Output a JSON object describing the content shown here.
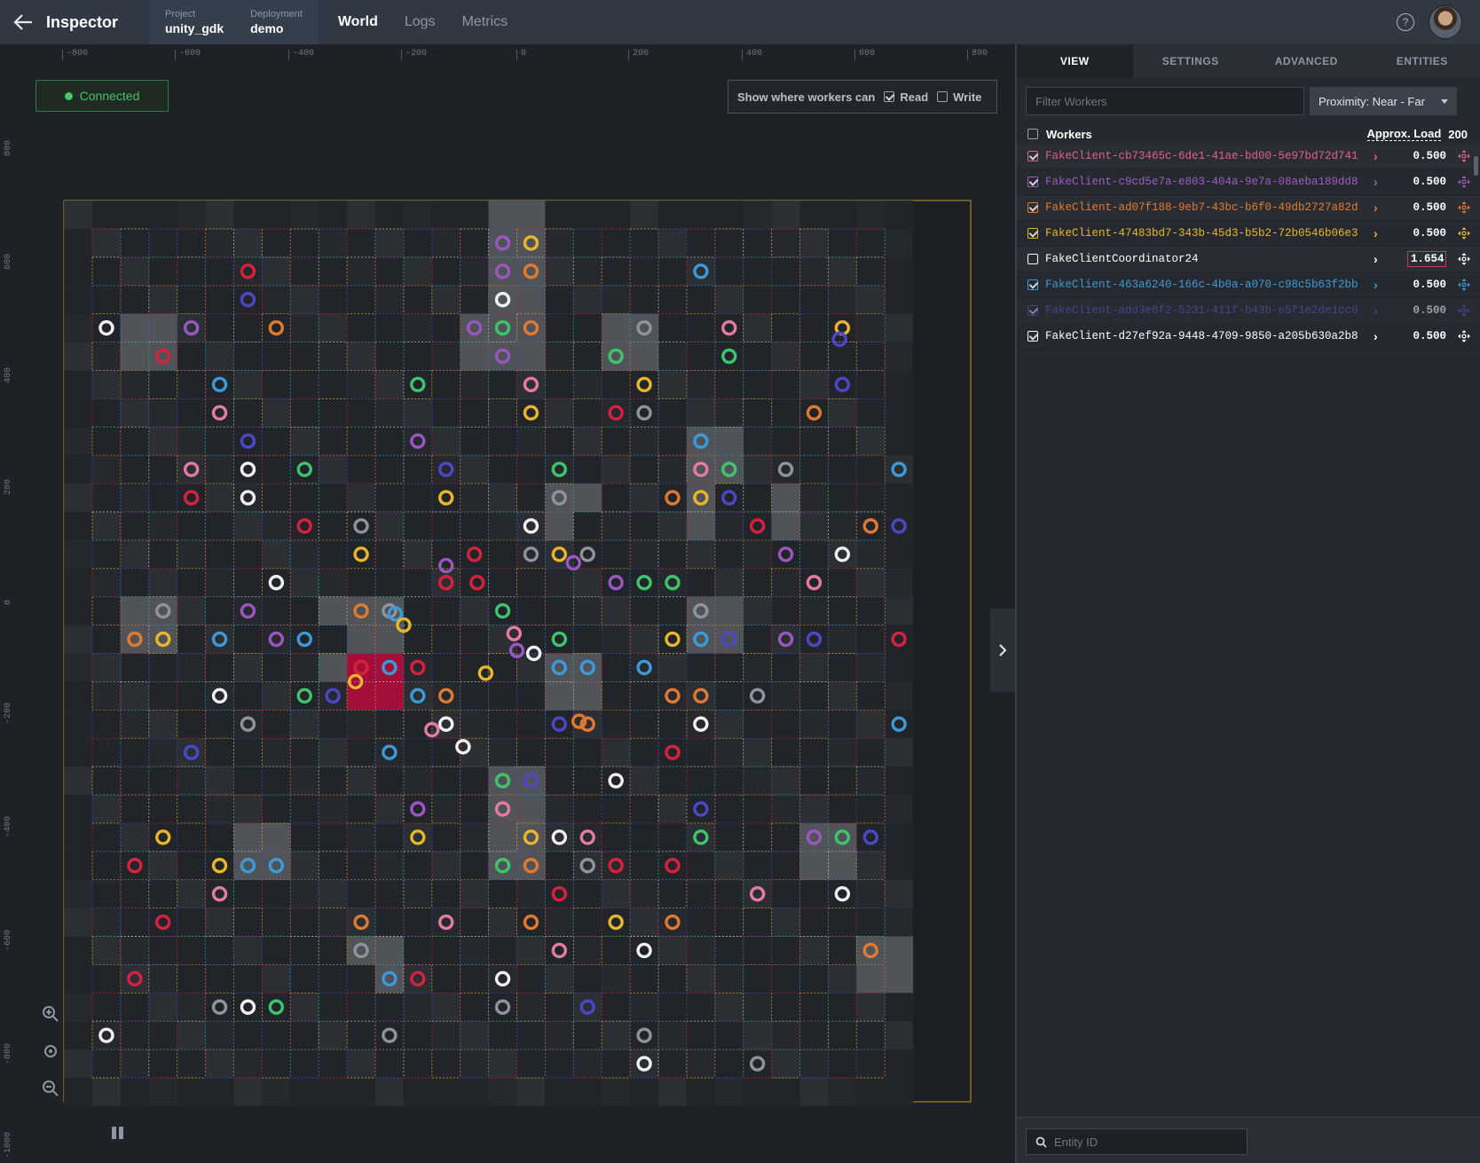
{
  "header": {
    "title": "Inspector",
    "project_label": "Project",
    "project_value": "unity_gdk",
    "deployment_label": "Deployment",
    "deployment_value": "demo",
    "tabs": [
      {
        "label": "World"
      },
      {
        "label": "Logs"
      },
      {
        "label": "Metrics"
      }
    ],
    "help_glyph": "?"
  },
  "map": {
    "status": "Connected",
    "ruler_x": [
      "-800",
      "-600",
      "-400",
      "-200",
      "0",
      "200",
      "400",
      "600",
      "800"
    ],
    "ruler_y": [
      "800",
      "600",
      "400",
      "200",
      "0",
      "-200",
      "-400",
      "-600",
      "-800",
      "-1000"
    ],
    "show_workers": {
      "label": "Show where workers can",
      "read": "Read",
      "write": "Write",
      "read_checked": true,
      "write_checked": false
    }
  },
  "panel": {
    "tabs": [
      {
        "label": "VIEW"
      },
      {
        "label": "SETTINGS"
      },
      {
        "label": "ADVANCED"
      },
      {
        "label": "ENTITIES"
      }
    ],
    "filter_placeholder": "Filter Workers",
    "proximity": "Proximity: Near - Far",
    "workers_label": "Workers",
    "approx_load_label": "Approx. Load",
    "approx_total": "200",
    "workers": [
      {
        "name": "FakeClient-cb73465c-6de1-41ae-bd00-5e97bd72d741",
        "load": "0.500",
        "color": "#e0608a",
        "checked": true
      },
      {
        "name": "FakeClient-c9cd5e7a-e803-404a-9e7a-08aeba189dd8",
        "load": "0.500",
        "color": "#9f5bc0",
        "checked": true
      },
      {
        "name": "FakeClient-ad07f188-9eb7-43bc-b6f0-49db2727a82d",
        "load": "0.500",
        "color": "#e67a2e",
        "checked": true
      },
      {
        "name": "FakeClient-47483bd7-343b-45d3-b5b2-72b0546b06e3",
        "load": "0.500",
        "color": "#e8b82a",
        "checked": true
      },
      {
        "name": "FakeClientCoordinator24",
        "load": "1.654",
        "color": "#ffffff",
        "checked": false
      },
      {
        "name": "FakeClient-463a6240-166c-4b0a-a070-c98c5b63f2bb",
        "load": "0.500",
        "color": "#3d9ad8",
        "checked": true
      },
      {
        "name": "FakeClient-add3e6f2-5231-411f-b43b-e5f1e2de1cc8",
        "load": "0.500",
        "color": "#5a5ad8",
        "checked": true
      },
      {
        "name": "FakeClient-d27ef92a-9448-4709-9850-a205b630a2b8",
        "load": "0.500",
        "color": "#ffffff",
        "checked": true
      }
    ],
    "entity_placeholder": "Entity ID"
  },
  "colors": {
    "red": "#d8203f",
    "pink": "#e57aa3",
    "purple": "#9a57c0",
    "orange": "#e07a30",
    "yellow": "#e8b52c",
    "green": "#3fc46e",
    "blue": "#3d9ad8",
    "indigo": "#4b48c8",
    "white": "#f2f2f2",
    "gray": "#8e9499"
  },
  "entities": [
    [
      14,
      0,
      "purple"
    ],
    [
      15,
      0,
      "yellow"
    ],
    [
      5,
      1,
      "red"
    ],
    [
      14,
      1,
      "purple"
    ],
    [
      15,
      1,
      "orange"
    ],
    [
      21,
      1,
      "blue"
    ],
    [
      5,
      2,
      "indigo"
    ],
    [
      14,
      2,
      "white"
    ],
    [
      0,
      3,
      "white"
    ],
    [
      3,
      3,
      "purple"
    ],
    [
      6,
      3,
      "orange"
    ],
    [
      13,
      3,
      "purple"
    ],
    [
      14,
      3,
      "green"
    ],
    [
      15,
      3,
      "orange"
    ],
    [
      19,
      3,
      "gray"
    ],
    [
      22,
      3,
      "pink"
    ],
    [
      26,
      3,
      "yellow"
    ],
    [
      2,
      4,
      "red"
    ],
    [
      14,
      4,
      "purple"
    ],
    [
      18,
      4,
      "green"
    ],
    [
      22,
      4,
      "green"
    ],
    [
      4,
      5,
      "blue"
    ],
    [
      11,
      5,
      "green"
    ],
    [
      15,
      5,
      "pink"
    ],
    [
      19,
      5,
      "yellow"
    ],
    [
      26,
      5,
      "indigo"
    ],
    [
      4,
      6,
      "pink"
    ],
    [
      15,
      6,
      "yellow"
    ],
    [
      18,
      6,
      "red"
    ],
    [
      19,
      6,
      "gray"
    ],
    [
      25,
      6,
      "orange"
    ],
    [
      5,
      7,
      "indigo"
    ],
    [
      11,
      7,
      "purple"
    ],
    [
      21,
      7,
      "blue"
    ],
    [
      3,
      8,
      "pink"
    ],
    [
      5,
      8,
      "white"
    ],
    [
      7,
      8,
      "green"
    ],
    [
      12,
      8,
      "indigo"
    ],
    [
      16,
      8,
      "green"
    ],
    [
      21,
      8,
      "pink"
    ],
    [
      22,
      8,
      "green"
    ],
    [
      24,
      8,
      "gray"
    ],
    [
      28,
      8,
      "blue"
    ],
    [
      3,
      9,
      "red"
    ],
    [
      5,
      9,
      "white"
    ],
    [
      12,
      9,
      "yellow"
    ],
    [
      16,
      9,
      "gray"
    ],
    [
      20,
      9,
      "orange"
    ],
    [
      21,
      9,
      "yellow"
    ],
    [
      22,
      9,
      "indigo"
    ],
    [
      7,
      10,
      "red"
    ],
    [
      9,
      10,
      "gray"
    ],
    [
      15,
      10,
      "white"
    ],
    [
      23,
      10,
      "red"
    ],
    [
      27,
      10,
      "orange"
    ],
    [
      28,
      10,
      "indigo"
    ],
    [
      9,
      11,
      "yellow"
    ],
    [
      13,
      11,
      "red"
    ],
    [
      15,
      11,
      "gray"
    ],
    [
      16,
      11,
      "yellow"
    ],
    [
      17,
      11,
      "gray"
    ],
    [
      24,
      11,
      "purple"
    ],
    [
      26,
      11,
      "white"
    ],
    [
      6,
      12,
      "white"
    ],
    [
      12,
      12,
      "red"
    ],
    [
      18,
      12,
      "purple"
    ],
    [
      19,
      12,
      "green"
    ],
    [
      20,
      12,
      "green"
    ],
    [
      25,
      12,
      "pink"
    ],
    [
      2,
      13,
      "gray"
    ],
    [
      5,
      13,
      "purple"
    ],
    [
      9,
      13,
      "orange"
    ],
    [
      10,
      13,
      "gray"
    ],
    [
      14,
      13,
      "green"
    ],
    [
      21,
      13,
      "gray"
    ],
    [
      1,
      14,
      "orange"
    ],
    [
      2,
      14,
      "yellow"
    ],
    [
      4,
      14,
      "blue"
    ],
    [
      6,
      14,
      "purple"
    ],
    [
      7,
      14,
      "blue"
    ],
    [
      16,
      14,
      "green"
    ],
    [
      20,
      14,
      "yellow"
    ],
    [
      21,
      14,
      "blue"
    ],
    [
      22,
      14,
      "indigo"
    ],
    [
      24,
      14,
      "purple"
    ],
    [
      25,
      14,
      "indigo"
    ],
    [
      28,
      14,
      "red"
    ],
    [
      9,
      15,
      "red"
    ],
    [
      10,
      15,
      "blue"
    ],
    [
      11,
      15,
      "red"
    ],
    [
      16,
      15,
      "blue"
    ],
    [
      17,
      15,
      "blue"
    ],
    [
      19,
      15,
      "blue"
    ],
    [
      4,
      16,
      "white"
    ],
    [
      7,
      16,
      "green"
    ],
    [
      8,
      16,
      "indigo"
    ],
    [
      11,
      16,
      "blue"
    ],
    [
      12,
      16,
      "orange"
    ],
    [
      20,
      16,
      "orange"
    ],
    [
      21,
      16,
      "orange"
    ],
    [
      23,
      16,
      "gray"
    ],
    [
      5,
      17,
      "gray"
    ],
    [
      12,
      17,
      "white"
    ],
    [
      16,
      17,
      "indigo"
    ],
    [
      17,
      17,
      "orange"
    ],
    [
      21,
      17,
      "white"
    ],
    [
      28,
      17,
      "blue"
    ],
    [
      3,
      18,
      "indigo"
    ],
    [
      10,
      18,
      "blue"
    ],
    [
      20,
      18,
      "red"
    ],
    [
      14,
      19,
      "green"
    ],
    [
      15,
      19,
      "indigo"
    ],
    [
      18,
      19,
      "white"
    ],
    [
      11,
      20,
      "purple"
    ],
    [
      14,
      20,
      "pink"
    ],
    [
      21,
      20,
      "indigo"
    ],
    [
      2,
      21,
      "yellow"
    ],
    [
      11,
      21,
      "yellow"
    ],
    [
      15,
      21,
      "yellow"
    ],
    [
      16,
      21,
      "white"
    ],
    [
      17,
      21,
      "pink"
    ],
    [
      21,
      21,
      "green"
    ],
    [
      25,
      21,
      "purple"
    ],
    [
      26,
      21,
      "green"
    ],
    [
      27,
      21,
      "indigo"
    ],
    [
      1,
      22,
      "red"
    ],
    [
      4,
      22,
      "yellow"
    ],
    [
      5,
      22,
      "blue"
    ],
    [
      6,
      22,
      "blue"
    ],
    [
      14,
      22,
      "green"
    ],
    [
      15,
      22,
      "orange"
    ],
    [
      17,
      22,
      "gray"
    ],
    [
      18,
      22,
      "red"
    ],
    [
      20,
      22,
      "red"
    ],
    [
      4,
      23,
      "pink"
    ],
    [
      16,
      23,
      "red"
    ],
    [
      23,
      23,
      "pink"
    ],
    [
      26,
      23,
      "white"
    ],
    [
      2,
      24,
      "red"
    ],
    [
      9,
      24,
      "orange"
    ],
    [
      12,
      24,
      "pink"
    ],
    [
      15,
      24,
      "orange"
    ],
    [
      18,
      24,
      "yellow"
    ],
    [
      20,
      24,
      "orange"
    ],
    [
      9,
      25,
      "gray"
    ],
    [
      16,
      25,
      "pink"
    ],
    [
      19,
      25,
      "white"
    ],
    [
      27,
      25,
      "orange"
    ],
    [
      1,
      26,
      "red"
    ],
    [
      10,
      26,
      "blue"
    ],
    [
      11,
      26,
      "red"
    ],
    [
      14,
      26,
      "white"
    ],
    [
      4,
      27,
      "gray"
    ],
    [
      5,
      27,
      "white"
    ],
    [
      6,
      27,
      "green"
    ],
    [
      14,
      27,
      "gray"
    ],
    [
      17,
      27,
      "indigo"
    ],
    [
      0,
      28,
      "white"
    ],
    [
      10,
      28,
      "gray"
    ],
    [
      19,
      28,
      "gray"
    ],
    [
      19,
      29,
      "white"
    ],
    [
      23,
      29,
      "gray"
    ]
  ],
  "loose_entities": [
    [
      12,
      11.4,
      "purple"
    ],
    [
      13.4,
      15.2,
      "yellow"
    ],
    [
      8.8,
      15.5,
      "yellow"
    ],
    [
      10.2,
      13.1,
      "blue"
    ],
    [
      10.5,
      13.5,
      "yellow"
    ],
    [
      14.4,
      13.8,
      "pink"
    ],
    [
      14.5,
      14.4,
      "purple"
    ],
    [
      13.1,
      12.0,
      "red"
    ],
    [
      15.1,
      14.5,
      "white"
    ],
    [
      11.5,
      17.2,
      "pink"
    ],
    [
      12.6,
      17.8,
      "white"
    ],
    [
      25.9,
      3.4,
      "indigo"
    ],
    [
      16.5,
      11.3,
      "purple"
    ],
    [
      16.7,
      16.9,
      "orange"
    ]
  ],
  "highlight_cells": [
    [
      14,
      -1
    ],
    [
      15,
      -1
    ],
    [
      14,
      0
    ],
    [
      15,
      0
    ],
    [
      14,
      1
    ],
    [
      15,
      1
    ],
    [
      14,
      2
    ],
    [
      15,
      2
    ],
    [
      14,
      3
    ],
    [
      15,
      3
    ],
    [
      14,
      4
    ],
    [
      15,
      4
    ],
    [
      1,
      3
    ],
    [
      2,
      3
    ],
    [
      1,
      4
    ],
    [
      2,
      4
    ],
    [
      13,
      3
    ],
    [
      13,
      4
    ],
    [
      18,
      3
    ],
    [
      19,
      3
    ],
    [
      18,
      4
    ],
    [
      19,
      4
    ],
    [
      21,
      7
    ],
    [
      22,
      7
    ],
    [
      21,
      8
    ],
    [
      22,
      8
    ],
    [
      21,
      9
    ],
    [
      21,
      10
    ],
    [
      24,
      9
    ],
    [
      24,
      10
    ],
    [
      1,
      13
    ],
    [
      2,
      13
    ],
    [
      1,
      14
    ],
    [
      2,
      14
    ],
    [
      8,
      13
    ],
    [
      9,
      13
    ],
    [
      10,
      13
    ],
    [
      9,
      14
    ],
    [
      10,
      14
    ],
    [
      8,
      15
    ],
    [
      9,
      15
    ],
    [
      16,
      15
    ],
    [
      17,
      15
    ],
    [
      16,
      16
    ],
    [
      17,
      16
    ],
    [
      21,
      13
    ],
    [
      22,
      13
    ],
    [
      21,
      14
    ],
    [
      22,
      14
    ],
    [
      14,
      19
    ],
    [
      15,
      19
    ],
    [
      14,
      20
    ],
    [
      15,
      20
    ],
    [
      5,
      21
    ],
    [
      6,
      21
    ],
    [
      5,
      22
    ],
    [
      6,
      22
    ],
    [
      14,
      21
    ],
    [
      15,
      21
    ],
    [
      14,
      22
    ],
    [
      15,
      22
    ],
    [
      25,
      21
    ],
    [
      26,
      21
    ],
    [
      25,
      22
    ],
    [
      26,
      22
    ],
    [
      9,
      25
    ],
    [
      10,
      25
    ],
    [
      10,
      26
    ],
    [
      27,
      25
    ],
    [
      28,
      25
    ],
    [
      27,
      26
    ],
    [
      28,
      26
    ],
    [
      16,
      16
    ],
    [
      16,
      9
    ],
    [
      17,
      9
    ],
    [
      16,
      10
    ]
  ],
  "red_cells": [
    [
      9,
      15
    ],
    [
      10,
      15
    ],
    [
      9,
      16
    ],
    [
      10,
      16
    ]
  ]
}
